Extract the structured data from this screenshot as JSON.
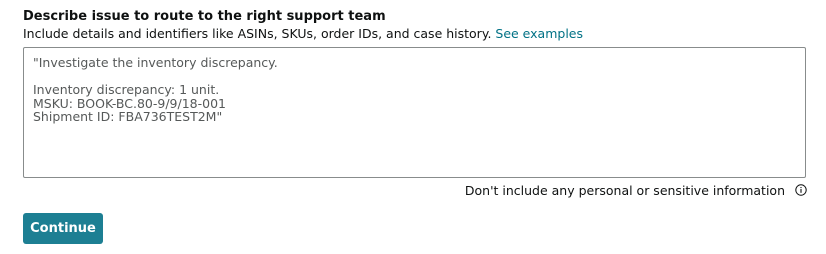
{
  "form": {
    "heading": "Describe issue to route to the right support team",
    "hint_text": "Include details and identifiers like ASINs, SKUs, order IDs, and case history. ",
    "hint_link": "See examples",
    "textarea_value": "\"Investigate the inventory discrepancy.\n\nInventory discrepancy: 1 unit.\nMSKU: BOOK-BC.80-9/9/18-001\nShipment ID: FBA736TEST2M\"",
    "privacy_notice": "Don't include any personal or sensitive information",
    "info_icon": "info-icon",
    "continue_label": "Continue"
  },
  "colors": {
    "link": "#007185",
    "button": "#1d7f93",
    "border": "#888c8c",
    "text_muted": "#565959"
  }
}
